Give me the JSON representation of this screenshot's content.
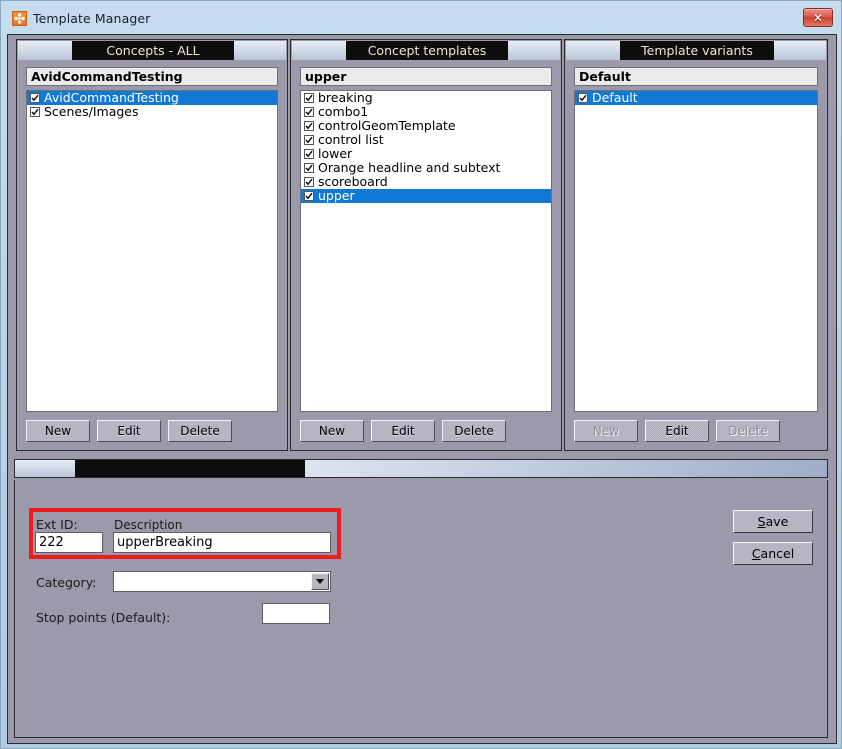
{
  "window": {
    "title": "Template Manager",
    "icon": "app-icon",
    "close_label": "✕"
  },
  "panels": [
    {
      "id": "concepts",
      "header": "Concepts - ALL",
      "filter_value": "AvidCommandTesting",
      "items": [
        {
          "label": "AvidCommandTesting",
          "checked": true,
          "selected": true
        },
        {
          "label": "Scenes/Images",
          "checked": true,
          "selected": false
        }
      ],
      "buttons": [
        {
          "label": "New",
          "state": "enabled"
        },
        {
          "label": "Edit",
          "state": "enabled"
        },
        {
          "label": "Delete",
          "state": "enabled"
        }
      ]
    },
    {
      "id": "templates",
      "header": "Concept templates",
      "filter_value": "upper",
      "items": [
        {
          "label": "breaking",
          "checked": true,
          "selected": false
        },
        {
          "label": "combo1",
          "checked": true,
          "selected": false
        },
        {
          "label": "controlGeomTemplate",
          "checked": true,
          "selected": false
        },
        {
          "label": "control list",
          "checked": true,
          "selected": false
        },
        {
          "label": "lower",
          "checked": true,
          "selected": false
        },
        {
          "label": "Orange headline and subtext",
          "checked": true,
          "selected": false
        },
        {
          "label": "scoreboard",
          "checked": true,
          "selected": false
        },
        {
          "label": "upper",
          "checked": true,
          "selected": true
        }
      ],
      "buttons": [
        {
          "label": "New",
          "state": "enabled"
        },
        {
          "label": "Edit",
          "state": "enabled"
        },
        {
          "label": "Delete",
          "state": "enabled"
        }
      ]
    },
    {
      "id": "variants",
      "header": "Template variants",
      "filter_value": "Default",
      "items": [
        {
          "label": "Default",
          "checked": true,
          "selected": true
        }
      ],
      "buttons": [
        {
          "label": "New",
          "state": "disabled"
        },
        {
          "label": "Edit",
          "state": "focused"
        },
        {
          "label": "Delete",
          "state": "disabled"
        }
      ]
    }
  ],
  "detail": {
    "header_title": "",
    "ext_id_label": "Ext ID:",
    "ext_id_value": "222",
    "description_label": "Description",
    "description_value": "upperBreaking",
    "category_label": "Category:",
    "category_value": "",
    "stop_points_label": "Stop points (Default):",
    "stop_points_value": "",
    "save_label": "Save",
    "save_accel": "S",
    "save_rest": "ave",
    "cancel_label": "Cancel",
    "cancel_accel": "C",
    "cancel_rest": "ancel"
  },
  "annotation": {
    "highlight_color": "#ee1c1c",
    "highlight_target": "ext-id-and-description-fields"
  },
  "colors": {
    "selection": "#1178d4",
    "window_background": "#9a9aaa",
    "titlebar": "#bcd4ea",
    "header_bar": "#0d0d0d",
    "header_text": "#efe6d2",
    "close_button": "#c9402f"
  }
}
